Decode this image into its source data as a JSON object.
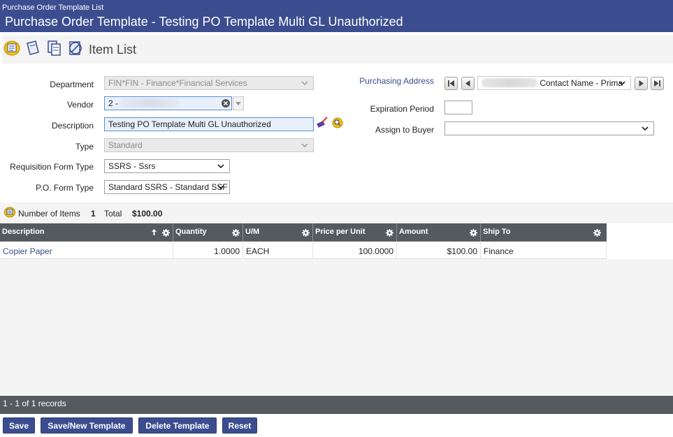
{
  "header": {
    "breadcrumb": "Purchase Order Template List",
    "title": "Purchase Order Template - Testing PO Template Multi GL Unauthorized"
  },
  "toolbar": {
    "section_label": "Item List"
  },
  "form": {
    "department": {
      "label": "Department",
      "value": "FIN*FIN - Finance*Financial Services"
    },
    "vendor": {
      "label": "Vendor",
      "value": "2 -"
    },
    "description": {
      "label": "Description",
      "value": "Testing PO Template Multi GL Unauthorized"
    },
    "type": {
      "label": "Type",
      "value": "Standard"
    },
    "requisition_form_type": {
      "label": "Requisition Form Type",
      "value": "SSRS - Ssrs"
    },
    "po_form_type": {
      "label": "P.O. Form Type",
      "value": "Standard SSRS - Standard SSF"
    },
    "purchasing_address": {
      "label": "Purchasing Address",
      "value": "Contact Name - Prima"
    },
    "expiration_period": {
      "label": "Expiration Period",
      "value": ""
    },
    "assign_to_buyer": {
      "label": "Assign to Buyer",
      "value": ""
    }
  },
  "summary": {
    "items_label": "Number of Items",
    "items_count": "1",
    "total_label": "Total",
    "total_value": "$100.00"
  },
  "grid": {
    "columns": [
      "Description",
      "Quantity",
      "U/M",
      "Price per Unit",
      "Amount",
      "Ship To"
    ],
    "rows": [
      {
        "description": "Copier Paper",
        "quantity": "1.0000",
        "um": "EACH",
        "price": "100.0000",
        "amount": "$100.00",
        "ship_to": "Finance"
      }
    ]
  },
  "pager": {
    "text": "1 - 1 of 1 records"
  },
  "buttons": {
    "save": "Save",
    "save_new": "Save/New Template",
    "delete": "Delete Template",
    "reset": "Reset"
  },
  "colors": {
    "header_bg": "#3b4d8f",
    "grid_header_bg": "#555a5e",
    "button_bg": "#3b4d8f",
    "link": "#3b4d8f"
  }
}
